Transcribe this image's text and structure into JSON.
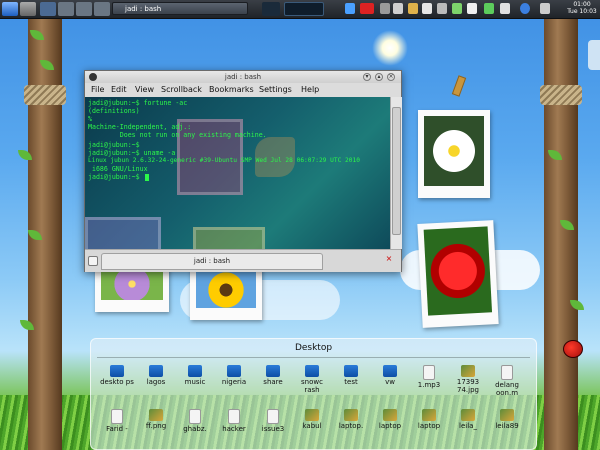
{
  "panel": {
    "task_title": "jadi : bash",
    "clock_time": "01:00",
    "clock_date": "Tue 10:03"
  },
  "konsole": {
    "title": "jadi : bash",
    "menu": [
      "File",
      "Edit",
      "View",
      "Scrollback",
      "Bookmarks",
      "Settings",
      "Help"
    ],
    "lines": [
      "jadi@jubun:~$ fortune -ac",
      "(definitions)",
      "%",
      "Machine-Independent, adj.:",
      "        Does not run on any existing machine.",
      "jadi@jubun:~$",
      "jadi@jubun:~$ uname -a",
      "Linux jubun 2.6.32-24-generic #39-Ubuntu SMP Wed Jul 28 06:07:29 UTC 2010",
      " i686 GNU/Linux",
      "jadi@jubun:~$ "
    ],
    "tab_label": "jadi : bash"
  },
  "desktop": {
    "title": "Desktop",
    "row1": [
      {
        "label": "deskto ps",
        "kind": "folder"
      },
      {
        "label": "lagos",
        "kind": "folder"
      },
      {
        "label": "music",
        "kind": "folder"
      },
      {
        "label": "nigeria",
        "kind": "folder"
      },
      {
        "label": "share",
        "kind": "folder"
      },
      {
        "label": "snowc rash",
        "kind": "folder"
      },
      {
        "label": "test",
        "kind": "folder"
      },
      {
        "label": "vw",
        "kind": "folder"
      },
      {
        "label": "1.mp3",
        "kind": "file"
      },
      {
        "label": "17393 74.jpg",
        "kind": "img"
      },
      {
        "label": "delang oon.m",
        "kind": "file"
      }
    ],
    "row2": [
      {
        "label": "Farid -",
        "kind": "file"
      },
      {
        "label": "ff.png",
        "kind": "img"
      },
      {
        "label": "ghabz.",
        "kind": "file"
      },
      {
        "label": "hacker",
        "kind": "file"
      },
      {
        "label": "issue3",
        "kind": "file"
      },
      {
        "label": "kabul",
        "kind": "img"
      },
      {
        "label": "laptop.",
        "kind": "img"
      },
      {
        "label": "laptop",
        "kind": "img"
      },
      {
        "label": "laptop",
        "kind": "img"
      },
      {
        "label": "leila_",
        "kind": "img"
      },
      {
        "label": "leila89",
        "kind": "img"
      }
    ]
  }
}
